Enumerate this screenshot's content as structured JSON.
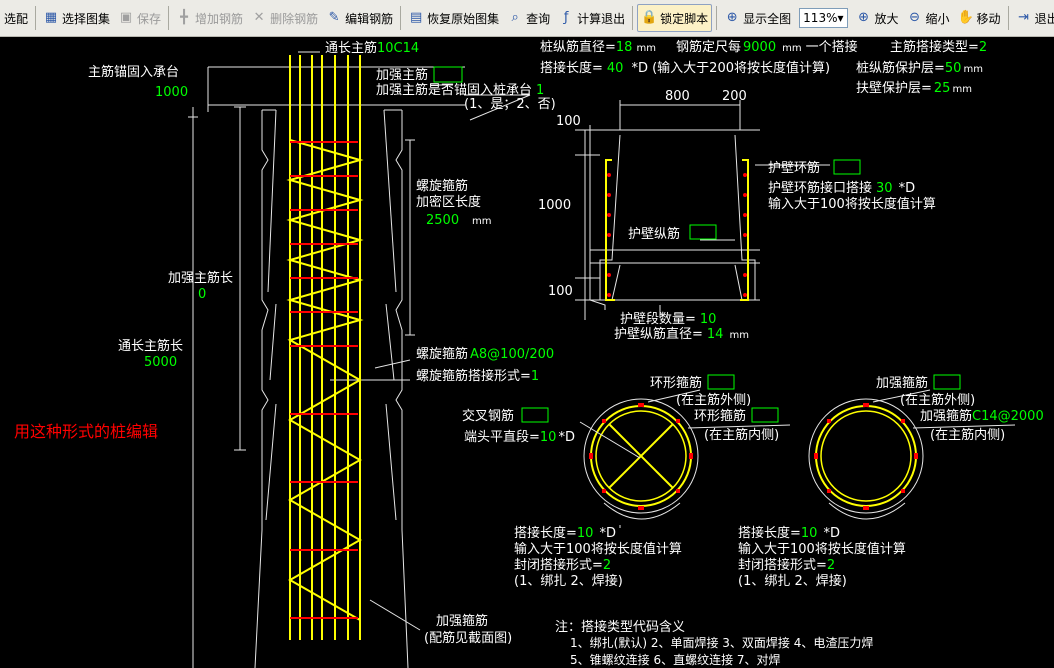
{
  "toolbar": {
    "items": [
      {
        "id": "select",
        "label": "选配",
        "icon": "select-icon"
      },
      {
        "id": "choose",
        "label": "选择图集",
        "icon": "xyz-atlas-icon"
      },
      {
        "id": "save",
        "label": "保存",
        "icon": "floppy-icon",
        "disabled": true
      },
      {
        "id": "add",
        "label": "增加钢筋",
        "icon": "add-rebar-icon",
        "disabled": true
      },
      {
        "id": "delete",
        "label": "删除钢筋",
        "icon": "delete-rebar-icon",
        "disabled": true
      },
      {
        "id": "edit",
        "label": "编辑钢筋",
        "icon": "edit-rebar-icon"
      },
      {
        "id": "restore",
        "label": "恢复原始图集",
        "icon": "restore-icon"
      },
      {
        "id": "query",
        "label": "查询",
        "icon": "query-icon"
      },
      {
        "id": "calcexit",
        "label": "计算退出",
        "icon": "fx-icon"
      },
      {
        "id": "lock",
        "label": "锁定脚本",
        "icon": "lock-icon",
        "pressed": true
      },
      {
        "id": "fit",
        "label": "显示全图",
        "icon": "fit-all-icon"
      },
      {
        "id": "zoomin",
        "label": "放大",
        "icon": "zoom-in-icon"
      },
      {
        "id": "zoomout",
        "label": "缩小",
        "icon": "zoom-out-icon"
      },
      {
        "id": "move",
        "label": "移动",
        "icon": "hand-icon"
      },
      {
        "id": "exit",
        "label": "退出",
        "icon": "exit-icon"
      }
    ],
    "zoom": "113%"
  },
  "colors": {
    "bg": "#000000",
    "white": "#ffffff",
    "green": "#00ff00",
    "yellow": "#ffff00",
    "red": "#ff0000",
    "line": "#e6e6e6"
  },
  "labels": {
    "through_main": "通长主筋",
    "through_main_val": "10C14",
    "anchor": "主筋锚固入承台",
    "anchor_val": "1000",
    "reinf_main": "加强主筋",
    "reinf_anchor_q": "加强主筋是否锚固入桩承台",
    "reinf_anchor_val": "1",
    "reinf_anchor_opts": "(1、是；2、否)",
    "spiral": "螺旋箍筋",
    "dense_len": "加密区长度",
    "dense_val": "2500",
    "mm": "mm",
    "reinf_len": "加强主筋长",
    "reinf_len_val": "0",
    "through_len": "通长主筋长",
    "through_len_val": "5000",
    "spiral2": "螺旋箍筋",
    "spiral_val": "A8@100/200",
    "spiral_lap": "螺旋箍筋搭接形式=",
    "spiral_lap_val": "1",
    "pile_note": "用这种形式的桩编辑",
    "reinf_stirrup": "加强箍筋",
    "reinf_stirrup_note": "(配筋见截面图)",
    "pile_dia": "桩纵筋直径=",
    "pile_dia_val": "18",
    "fixed_len": "钢筋定尺每",
    "fixed_len_val": "9000",
    "one_lap": "一个搭接",
    "main_lap_type": "主筋搭接类型=",
    "main_lap_type_val": "2",
    "lap_len": "搭接长度=",
    "lap_len_val": "40",
    "lap_len_note": "*D (输入大于200将按长度值计算)",
    "pile_cover": "桩纵筋保护层=",
    "pile_cover_val": "50",
    "wall_cover": "扶壁保护层=",
    "wall_cover_val": "25",
    "dim_800": "800",
    "dim_200": "200",
    "dim_100a": "100",
    "dim_1000": "1000",
    "dim_100b": "100",
    "wall_ring": "护壁环筋",
    "wall_ring_lap": "护壁环筋接口搭接",
    "wall_ring_lap_val": "30",
    "d_unit": "*D",
    "input_note": "输入大于100将按长度值计算",
    "wall_long": "护壁纵筋",
    "wall_seg_cnt": "护壁段数量=",
    "wall_seg_cnt_val": "10",
    "wall_long_dia": "护壁纵筋直径=",
    "wall_long_dia_val": "14",
    "ring_stirrup": "环形箍筋",
    "outer": "(在主筋外侧)",
    "inner": "(在主筋内侧)",
    "cross_bar": "交叉钢筋",
    "end_straight": "端头平直段=",
    "end_straight_val": "10",
    "reinf_stirrup2": "加强箍筋",
    "reinf_stirrup2_val": "C14@2000",
    "lap_len2": "搭接长度=",
    "lap_len2_val": "10",
    "seal_lap": "封闭搭接形式=",
    "seal_lap_val": "2",
    "seal_opts": "(1、绑扎  2、焊接)",
    "note_title": "注：搭接类型代码含义",
    "note_line1": "1、绑扎(默认)    2、单面焊接    3、双面焊接    4、电渣压力焊",
    "note_line2": "5、锥螺纹连接    6、直螺纹连接    7、对焊"
  }
}
